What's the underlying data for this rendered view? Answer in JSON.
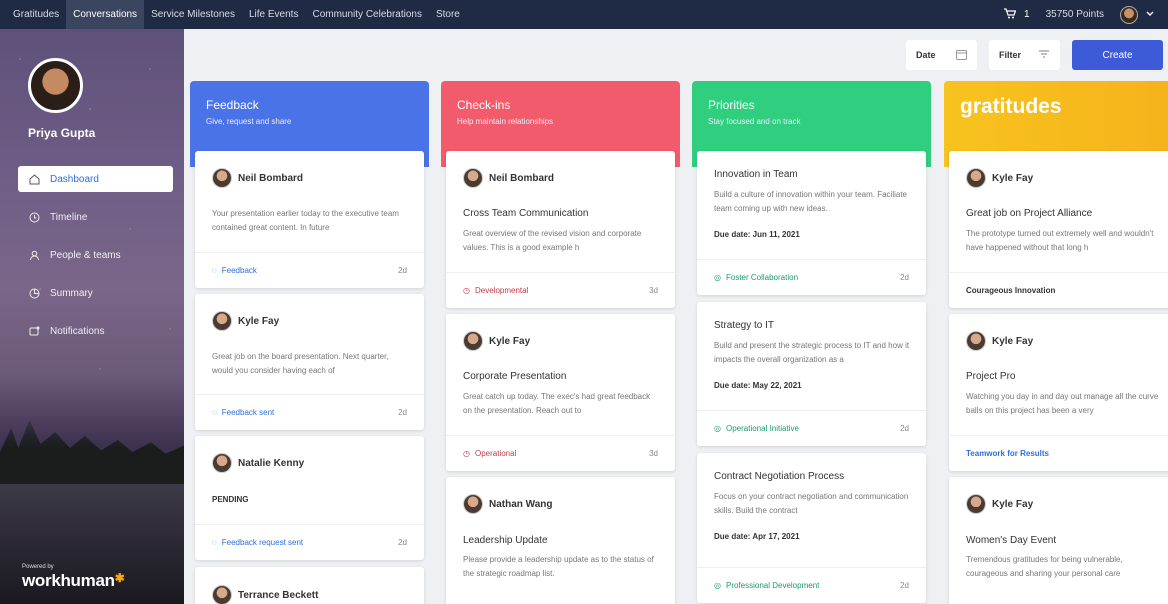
{
  "topbar": {
    "nav": [
      "Gratitudes",
      "Conversations",
      "Service Milestones",
      "Life Events",
      "Community Celebrations",
      "Store"
    ],
    "active_index": 1,
    "cart_count": "1",
    "points": "35750 Points"
  },
  "sidebar": {
    "user_name": "Priya Gupta",
    "items": [
      {
        "label": "Dashboard",
        "icon": "home-icon"
      },
      {
        "label": "Timeline",
        "icon": "clock-icon"
      },
      {
        "label": "People & teams",
        "icon": "people-icon"
      },
      {
        "label": "Summary",
        "icon": "pie-chart-icon"
      },
      {
        "label": "Notifications",
        "icon": "bell-icon"
      }
    ],
    "powered_by": "Powered by",
    "brand": "workhuman"
  },
  "toolbar": {
    "date_label": "Date",
    "filter_label": "Filter",
    "create_label": "Create"
  },
  "columns": [
    {
      "title": "Feedback",
      "subtitle": "Give, request and share",
      "color": "#4b73e8",
      "cards": [
        {
          "name": "Neil Bombard",
          "body": "Your presentation earlier today to the executive team contained great content. In future",
          "tag": "Feedback",
          "age": "2d"
        },
        {
          "name": "Kyle Fay",
          "body": "Great job on the board presentation. Next quarter, would you consider having each of",
          "tag": "Feedback sent",
          "age": "2d"
        },
        {
          "name": "Natalie Kenny",
          "status": "PENDING",
          "tag": "Feedback request sent",
          "age": "2d"
        },
        {
          "name": "Terrance Beckett"
        }
      ]
    },
    {
      "title": "Check-ins",
      "subtitle": "Help maintain relationships",
      "color": "#f15b6c",
      "cards": [
        {
          "name": "Neil Bombard",
          "title": "Cross Team Communication",
          "body": "Great overview of the revised vision and corporate values. This is a good example h",
          "tag": "Developmental",
          "age": "3d"
        },
        {
          "name": "Kyle Fay",
          "title": "Corporate Presentation",
          "body": "Great catch up today. The exec's had great feedback on the presentation. Reach out to",
          "tag": "Operational",
          "age": "3d"
        },
        {
          "name": "Nathan Wang",
          "title": "Leadership Update",
          "body": "Please provide a leadership update as to the status of the strategic roadmap list."
        }
      ]
    },
    {
      "title": "Priorities",
      "subtitle": "Stay focused and on track",
      "color": "#2fcf7f",
      "cards": [
        {
          "title": "Innovation in Team",
          "body": "Build a culture of innovation within your team. Faciliate team coming up with new ideas.",
          "due": "Due date: Jun 11, 2021",
          "tag": "Foster Collaboration",
          "age": "2d"
        },
        {
          "title": "Strategy to IT",
          "body": "Build and present the strategic process to IT and how it impacts the overall organization as a",
          "due": "Due date: May 22, 2021",
          "tag": "Operational Initiative",
          "age": "2d"
        },
        {
          "title": "Contract Negotiation Process",
          "body": "Focus on your contract negotiation and communication skills. Build the contract",
          "due": "Due date: Apr 17, 2021",
          "tag": "Professional Development",
          "age": "2d"
        }
      ]
    },
    {
      "title": "gratitudes",
      "color": "#f7c31e",
      "cards": [
        {
          "name": "Kyle Fay",
          "title": "Great job on Project Alliance",
          "body": "The prototype turned out extremely well and wouldn't have happened without that long h",
          "tag": "Courageous Innovation"
        },
        {
          "name": "Kyle Fay",
          "title": "Project Pro",
          "body": "Watching you day in and day out manage all the curve balls on this project has been a very",
          "tag": "Teamwork for Results"
        },
        {
          "name": "Kyle Fay",
          "title": "Women's Day Event",
          "body": "Tremendous gratitudes for being vulnerable, courageous and sharing your personal care"
        }
      ]
    }
  ]
}
